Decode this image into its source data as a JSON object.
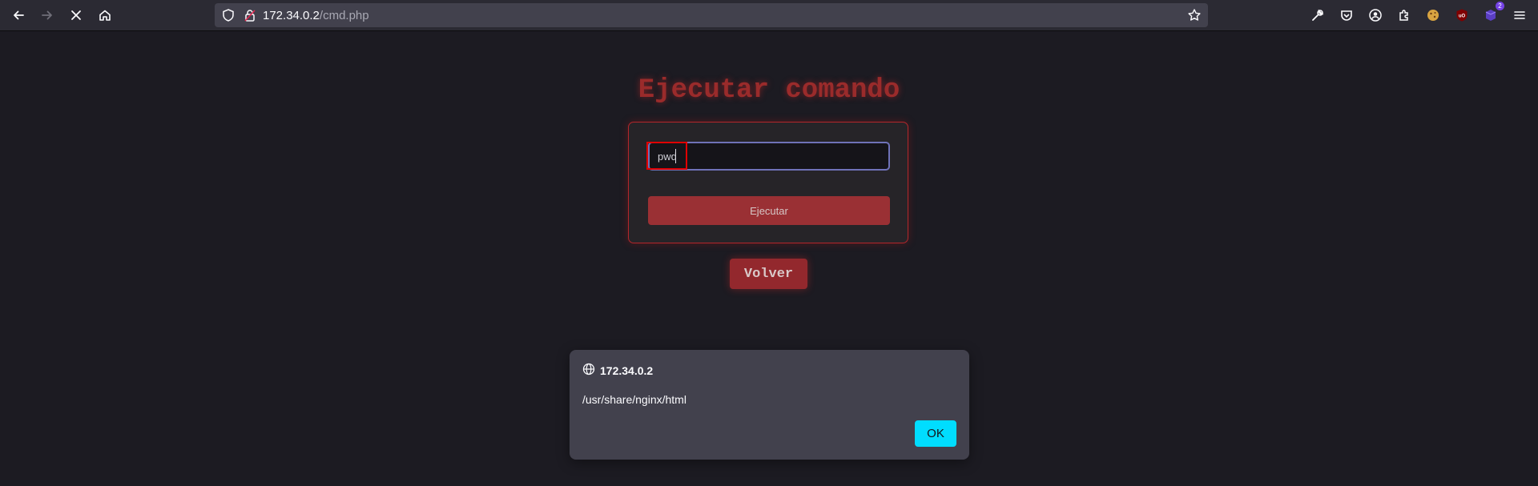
{
  "browser": {
    "url_host": "172.34.0.2",
    "url_path": "/cmd.php",
    "extension_badge": "2"
  },
  "page": {
    "title": "Ejecutar comando",
    "command_value": "pwd",
    "execute_label": "Ejecutar",
    "back_label": "Volver"
  },
  "dialog": {
    "origin": "172.34.0.2",
    "message": "/usr/share/nginx/html",
    "ok_label": "OK"
  },
  "colors": {
    "accent_red": "#9a3034",
    "dialog_ok": "#00ddff"
  }
}
